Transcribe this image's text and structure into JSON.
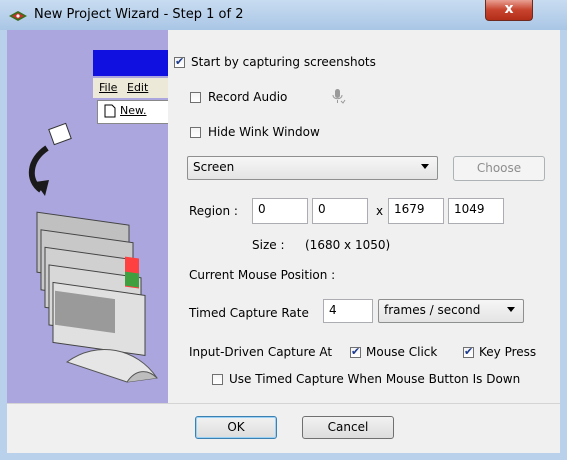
{
  "window": {
    "title": "New Project Wizard - Step 1 of 2",
    "close_label": "x"
  },
  "preview": {
    "menu_file": "File",
    "menu_edit": "Edit",
    "submenu_new": "New."
  },
  "options": {
    "start_capture": {
      "label": "Start by capturing screenshots",
      "checked": true
    },
    "record_audio": {
      "label": "Record Audio",
      "checked": false
    },
    "hide_window": {
      "label": "Hide Wink Window",
      "checked": false
    }
  },
  "capture_source": {
    "selected": "Screen",
    "choose_label": "Choose"
  },
  "region": {
    "label": "Region :",
    "x1": "0",
    "y1": "0",
    "x_sep": "x",
    "x2": "1679",
    "y2": "1049"
  },
  "size": {
    "label": "Size :",
    "value": "(1680 x 1050)"
  },
  "mouse_position_label": "Current Mouse Position :",
  "timed_capture": {
    "label": "Timed Capture Rate",
    "value": "4",
    "unit": "frames / second"
  },
  "input_driven": {
    "label": "Input-Driven Capture At",
    "mouse_click": {
      "label": "Mouse Click",
      "checked": true
    },
    "key_press": {
      "label": "Key Press",
      "checked": true
    }
  },
  "timed_when_down": {
    "label": "Use Timed Capture When Mouse Button Is Down",
    "checked": false
  },
  "buttons": {
    "ok": "OK",
    "cancel": "Cancel"
  },
  "colors": {
    "panel_bg": "#aba6dd",
    "mini_titlebar": "#1010e0"
  }
}
